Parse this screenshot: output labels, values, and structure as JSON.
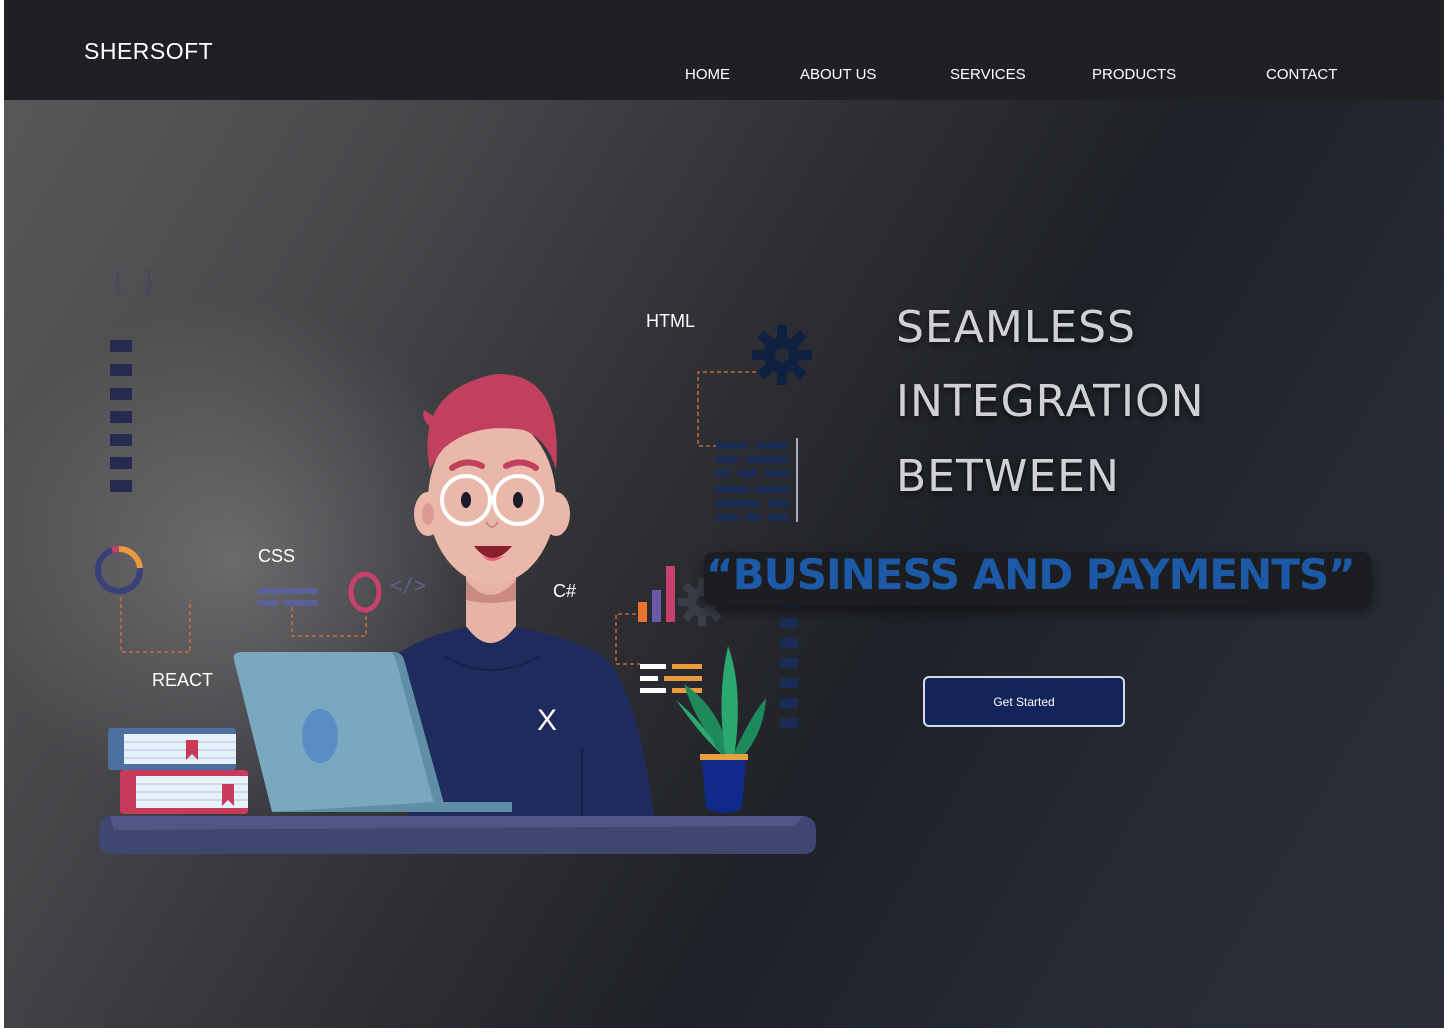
{
  "brand": {
    "name": "SHERSOFT"
  },
  "nav": {
    "items": [
      {
        "label": "HOME"
      },
      {
        "label": "ABOUT US"
      },
      {
        "label": "SERVICES"
      },
      {
        "label": "PRODUCTS"
      },
      {
        "label": "CONTACT"
      }
    ]
  },
  "hero": {
    "line1": "SEAMLESS",
    "line2": "INTEGRATION",
    "line3": "BETWEEN",
    "highlight": "“BUSINESS AND PAYMENTS”",
    "cta_label": "Get Started"
  },
  "illustration": {
    "labels": {
      "html": "HTML",
      "css": "CSS",
      "csharp": "C#",
      "react": "REACT",
      "x": "X",
      "braces": "{ }",
      "code_tag": "</>"
    }
  },
  "colors": {
    "header_bg": "#1f2024",
    "accent_blue": "#1c5aa8",
    "cta_bg": "#13245a",
    "hair": "#c0405e",
    "shirt": "#1f2b5c"
  }
}
